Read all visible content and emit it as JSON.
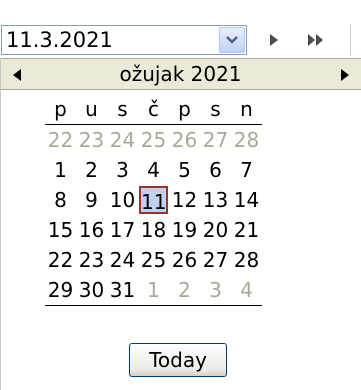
{
  "date_field": {
    "value": "11.3.2021"
  },
  "calendar": {
    "month_title": "ožujak 2021",
    "weekdays": [
      "p",
      "u",
      "s",
      "č",
      "p",
      "s",
      "n"
    ],
    "weeks": [
      [
        {
          "d": "22",
          "other": true
        },
        {
          "d": "23",
          "other": true
        },
        {
          "d": "24",
          "other": true
        },
        {
          "d": "25",
          "other": true
        },
        {
          "d": "26",
          "other": true
        },
        {
          "d": "27",
          "other": true
        },
        {
          "d": "28",
          "other": true
        }
      ],
      [
        {
          "d": "1"
        },
        {
          "d": "2"
        },
        {
          "d": "3"
        },
        {
          "d": "4"
        },
        {
          "d": "5"
        },
        {
          "d": "6"
        },
        {
          "d": "7"
        }
      ],
      [
        {
          "d": "8"
        },
        {
          "d": "9"
        },
        {
          "d": "10"
        },
        {
          "d": "11",
          "selected": true
        },
        {
          "d": "12"
        },
        {
          "d": "13"
        },
        {
          "d": "14"
        }
      ],
      [
        {
          "d": "15"
        },
        {
          "d": "16"
        },
        {
          "d": "17"
        },
        {
          "d": "18"
        },
        {
          "d": "19"
        },
        {
          "d": "20"
        },
        {
          "d": "21"
        }
      ],
      [
        {
          "d": "22"
        },
        {
          "d": "23"
        },
        {
          "d": "24"
        },
        {
          "d": "25"
        },
        {
          "d": "26"
        },
        {
          "d": "27"
        },
        {
          "d": "28"
        }
      ],
      [
        {
          "d": "29"
        },
        {
          "d": "30"
        },
        {
          "d": "31"
        },
        {
          "d": "1",
          "other": true
        },
        {
          "d": "2",
          "other": true
        },
        {
          "d": "3",
          "other": true
        },
        {
          "d": "4",
          "other": true
        }
      ]
    ],
    "today_label": "Today"
  },
  "icons": {
    "dropdown": "chevron-down-icon",
    "next": "play-right-icon",
    "fast_forward": "fast-forward-icon",
    "prev_month": "triangle-left-icon",
    "next_month": "triangle-right-icon"
  },
  "colors": {
    "header_bg": "#ece9d8",
    "other_month_text": "#aca899",
    "selected_bg": "#c1d2ee",
    "selected_border": "#a0302c",
    "input_border": "#7f9db9"
  }
}
